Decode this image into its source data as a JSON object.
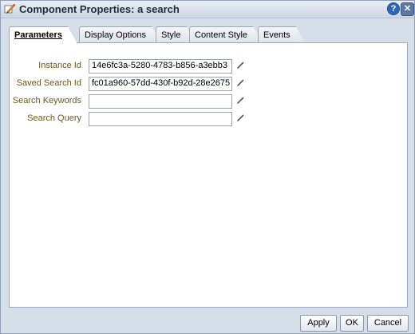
{
  "window": {
    "title": "Component Properties: a search",
    "help_icon": "help-icon",
    "close_icon": "close-icon"
  },
  "tabs": [
    {
      "label": "Parameters",
      "active": true
    },
    {
      "label": "Display Options",
      "active": false
    },
    {
      "label": "Style",
      "active": false
    },
    {
      "label": "Content Style",
      "active": false
    },
    {
      "label": "Events",
      "active": false
    }
  ],
  "fields": [
    {
      "label": "Instance Id",
      "value": "14e6fc3a-5280-4783-b856-a3ebb3"
    },
    {
      "label": "Saved Search Id",
      "value": "fc01a960-57dd-430f-b92d-28e2675"
    },
    {
      "label": "Search Keywords",
      "value": ""
    },
    {
      "label": "Search Query",
      "value": ""
    }
  ],
  "buttons": {
    "apply": "Apply",
    "ok": "OK",
    "cancel": "Cancel"
  },
  "colors": {
    "label_text": "#6b5a1e",
    "dialog_bg": "#d6deea",
    "panel_bg": "#ffffff"
  }
}
